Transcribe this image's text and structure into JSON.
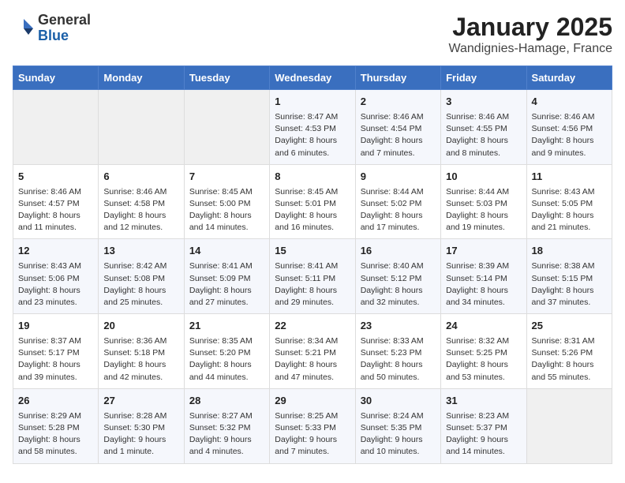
{
  "header": {
    "logo_general": "General",
    "logo_blue": "Blue",
    "month_title": "January 2025",
    "location": "Wandignies-Hamage, France"
  },
  "days_of_week": [
    "Sunday",
    "Monday",
    "Tuesday",
    "Wednesday",
    "Thursday",
    "Friday",
    "Saturday"
  ],
  "weeks": [
    [
      {
        "day": "",
        "content": ""
      },
      {
        "day": "",
        "content": ""
      },
      {
        "day": "",
        "content": ""
      },
      {
        "day": "1",
        "content": "Sunrise: 8:47 AM\nSunset: 4:53 PM\nDaylight: 8 hours\nand 6 minutes."
      },
      {
        "day": "2",
        "content": "Sunrise: 8:46 AM\nSunset: 4:54 PM\nDaylight: 8 hours\nand 7 minutes."
      },
      {
        "day": "3",
        "content": "Sunrise: 8:46 AM\nSunset: 4:55 PM\nDaylight: 8 hours\nand 8 minutes."
      },
      {
        "day": "4",
        "content": "Sunrise: 8:46 AM\nSunset: 4:56 PM\nDaylight: 8 hours\nand 9 minutes."
      }
    ],
    [
      {
        "day": "5",
        "content": "Sunrise: 8:46 AM\nSunset: 4:57 PM\nDaylight: 8 hours\nand 11 minutes."
      },
      {
        "day": "6",
        "content": "Sunrise: 8:46 AM\nSunset: 4:58 PM\nDaylight: 8 hours\nand 12 minutes."
      },
      {
        "day": "7",
        "content": "Sunrise: 8:45 AM\nSunset: 5:00 PM\nDaylight: 8 hours\nand 14 minutes."
      },
      {
        "day": "8",
        "content": "Sunrise: 8:45 AM\nSunset: 5:01 PM\nDaylight: 8 hours\nand 16 minutes."
      },
      {
        "day": "9",
        "content": "Sunrise: 8:44 AM\nSunset: 5:02 PM\nDaylight: 8 hours\nand 17 minutes."
      },
      {
        "day": "10",
        "content": "Sunrise: 8:44 AM\nSunset: 5:03 PM\nDaylight: 8 hours\nand 19 minutes."
      },
      {
        "day": "11",
        "content": "Sunrise: 8:43 AM\nSunset: 5:05 PM\nDaylight: 8 hours\nand 21 minutes."
      }
    ],
    [
      {
        "day": "12",
        "content": "Sunrise: 8:43 AM\nSunset: 5:06 PM\nDaylight: 8 hours\nand 23 minutes."
      },
      {
        "day": "13",
        "content": "Sunrise: 8:42 AM\nSunset: 5:08 PM\nDaylight: 8 hours\nand 25 minutes."
      },
      {
        "day": "14",
        "content": "Sunrise: 8:41 AM\nSunset: 5:09 PM\nDaylight: 8 hours\nand 27 minutes."
      },
      {
        "day": "15",
        "content": "Sunrise: 8:41 AM\nSunset: 5:11 PM\nDaylight: 8 hours\nand 29 minutes."
      },
      {
        "day": "16",
        "content": "Sunrise: 8:40 AM\nSunset: 5:12 PM\nDaylight: 8 hours\nand 32 minutes."
      },
      {
        "day": "17",
        "content": "Sunrise: 8:39 AM\nSunset: 5:14 PM\nDaylight: 8 hours\nand 34 minutes."
      },
      {
        "day": "18",
        "content": "Sunrise: 8:38 AM\nSunset: 5:15 PM\nDaylight: 8 hours\nand 37 minutes."
      }
    ],
    [
      {
        "day": "19",
        "content": "Sunrise: 8:37 AM\nSunset: 5:17 PM\nDaylight: 8 hours\nand 39 minutes."
      },
      {
        "day": "20",
        "content": "Sunrise: 8:36 AM\nSunset: 5:18 PM\nDaylight: 8 hours\nand 42 minutes."
      },
      {
        "day": "21",
        "content": "Sunrise: 8:35 AM\nSunset: 5:20 PM\nDaylight: 8 hours\nand 44 minutes."
      },
      {
        "day": "22",
        "content": "Sunrise: 8:34 AM\nSunset: 5:21 PM\nDaylight: 8 hours\nand 47 minutes."
      },
      {
        "day": "23",
        "content": "Sunrise: 8:33 AM\nSunset: 5:23 PM\nDaylight: 8 hours\nand 50 minutes."
      },
      {
        "day": "24",
        "content": "Sunrise: 8:32 AM\nSunset: 5:25 PM\nDaylight: 8 hours\nand 53 minutes."
      },
      {
        "day": "25",
        "content": "Sunrise: 8:31 AM\nSunset: 5:26 PM\nDaylight: 8 hours\nand 55 minutes."
      }
    ],
    [
      {
        "day": "26",
        "content": "Sunrise: 8:29 AM\nSunset: 5:28 PM\nDaylight: 8 hours\nand 58 minutes."
      },
      {
        "day": "27",
        "content": "Sunrise: 8:28 AM\nSunset: 5:30 PM\nDaylight: 9 hours\nand 1 minute."
      },
      {
        "day": "28",
        "content": "Sunrise: 8:27 AM\nSunset: 5:32 PM\nDaylight: 9 hours\nand 4 minutes."
      },
      {
        "day": "29",
        "content": "Sunrise: 8:25 AM\nSunset: 5:33 PM\nDaylight: 9 hours\nand 7 minutes."
      },
      {
        "day": "30",
        "content": "Sunrise: 8:24 AM\nSunset: 5:35 PM\nDaylight: 9 hours\nand 10 minutes."
      },
      {
        "day": "31",
        "content": "Sunrise: 8:23 AM\nSunset: 5:37 PM\nDaylight: 9 hours\nand 14 minutes."
      },
      {
        "day": "",
        "content": ""
      }
    ]
  ]
}
